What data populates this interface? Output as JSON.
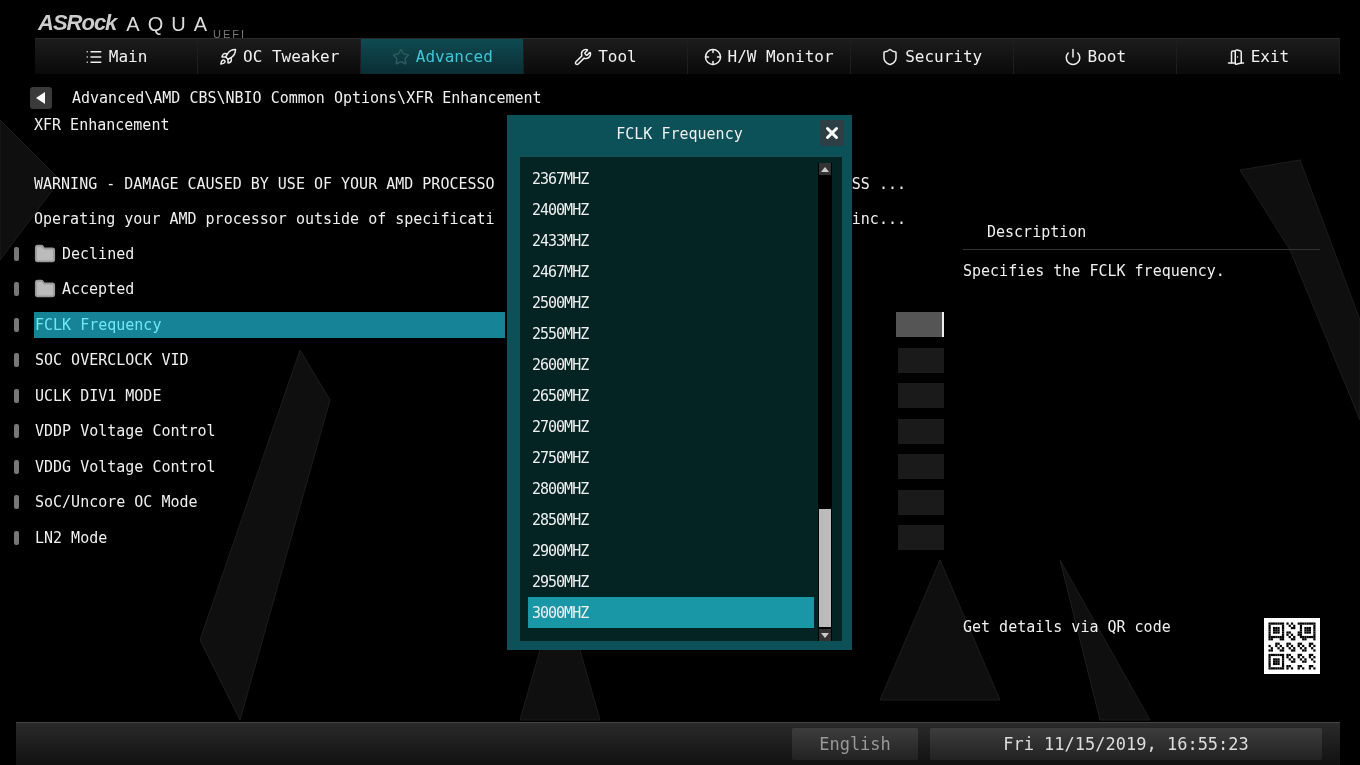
{
  "logo": {
    "brand": "ASRock",
    "product": "AQUA",
    "edition": "UEFI"
  },
  "tabs": [
    {
      "label": "Main",
      "selected": false
    },
    {
      "label": "OC Tweaker",
      "selected": false
    },
    {
      "label": "Advanced",
      "selected": true
    },
    {
      "label": "Tool",
      "selected": false
    },
    {
      "label": "H/W Monitor",
      "selected": false
    },
    {
      "label": "Security",
      "selected": false
    },
    {
      "label": "Boot",
      "selected": false
    },
    {
      "label": "Exit",
      "selected": false
    }
  ],
  "breadcrumb": "Advanced\\AMD CBS\\NBIO Common Options\\XFR Enhancement",
  "page_title": "XFR Enhancement",
  "warnings": [
    {
      "left": "WARNING - DAMAGE CAUSED BY USE OF YOUR AMD PROCESSO",
      "right": "SS ..."
    },
    {
      "left": "Operating your AMD processor outside of specificati",
      "right": "inc..."
    }
  ],
  "settings": [
    {
      "kind": "folder",
      "label": "Declined"
    },
    {
      "kind": "folder",
      "label": "Accepted"
    },
    {
      "kind": "option",
      "label": "FCLK Frequency",
      "selected": true
    },
    {
      "kind": "option",
      "label": "SOC OVERCLOCK VID",
      "selected": false
    },
    {
      "kind": "option",
      "label": "UCLK DIV1 MODE",
      "selected": false
    },
    {
      "kind": "option",
      "label": "VDDP Voltage Control",
      "selected": false
    },
    {
      "kind": "option",
      "label": "VDDG Voltage Control",
      "selected": false
    },
    {
      "kind": "option",
      "label": "SoC/Uncore OC Mode",
      "selected": false
    },
    {
      "kind": "option",
      "label": "LN2 Mode",
      "selected": false
    }
  ],
  "dialog": {
    "title": "FCLK Frequency",
    "options": [
      {
        "label": "2367MHZ",
        "selected": false
      },
      {
        "label": "2400MHZ",
        "selected": false
      },
      {
        "label": "2433MHZ",
        "selected": false
      },
      {
        "label": "2467MHZ",
        "selected": false
      },
      {
        "label": "2500MHZ",
        "selected": false
      },
      {
        "label": "2550MHZ",
        "selected": false
      },
      {
        "label": "2600MHZ",
        "selected": false
      },
      {
        "label": "2650MHZ",
        "selected": false
      },
      {
        "label": "2700MHZ",
        "selected": false
      },
      {
        "label": "2750MHZ",
        "selected": false
      },
      {
        "label": "2800MHZ",
        "selected": false
      },
      {
        "label": "2850MHZ",
        "selected": false
      },
      {
        "label": "2900MHZ",
        "selected": false
      },
      {
        "label": "2950MHZ",
        "selected": false
      },
      {
        "label": "3000MHZ",
        "selected": true
      }
    ]
  },
  "description": {
    "heading": "Description",
    "text": "Specifies the FCLK frequency.",
    "qr_caption": "Get details via QR code"
  },
  "footer": {
    "language": "English",
    "datetime": "Fri 11/15/2019, 16:55:23"
  }
}
